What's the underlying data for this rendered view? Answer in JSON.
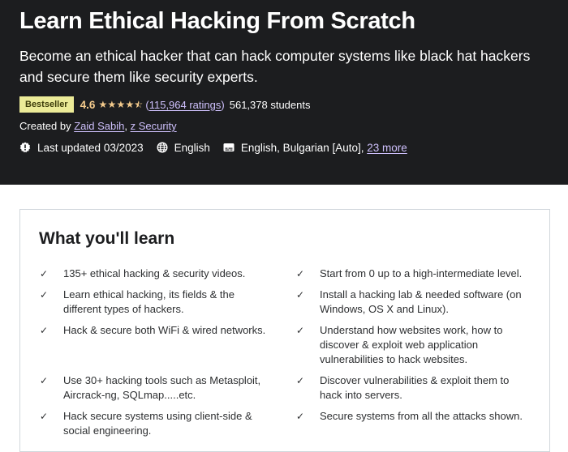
{
  "course": {
    "title": "Learn Ethical Hacking From Scratch",
    "subtitle": "Become an ethical hacker that can hack computer systems like black hat hackers and secure them like security experts.",
    "badge": "Bestseller",
    "rating": "4.6",
    "stars": {
      "value": 4.6,
      "max": 5
    },
    "ratings_open": "(",
    "ratings_link": "115,964 ratings",
    "ratings_close": ")",
    "students": "561,378 students",
    "created_by_label": "Created by",
    "instructors": [
      "Zaid Sabih",
      "z Security"
    ],
    "instructor_separator": ", ",
    "last_updated": "Last updated 03/2023",
    "language": "English",
    "captions": "English, Bulgarian [Auto],",
    "captions_more_link": "23 more"
  },
  "icons": {
    "update": "alert-badge-icon",
    "language": "globe-icon",
    "captions": "closed-captions-icon",
    "check": "checkmark-icon",
    "star": "star-icon"
  },
  "colors": {
    "hero_bg": "#1c1d1f",
    "badge_bg": "#eceb98",
    "star": "#f3ca8c",
    "link": "#cec0fc"
  },
  "learn": {
    "title": "What you'll learn",
    "left": [
      "135+ ethical hacking & security videos.",
      "Learn ethical hacking, its fields & the different types of hackers.",
      "Hack & secure both WiFi & wired networks.",
      "Use 30+ hacking tools such as Metasploit, Aircrack-ng, SQLmap.....etc.",
      "Hack secure systems using client-side & social engineering."
    ],
    "right": [
      "Start from 0 up to a high-intermediate level.",
      "Install a hacking lab & needed software (on Windows, OS X and Linux).",
      "Understand how websites work, how to discover & exploit web application vulnerabilities to hack websites.",
      "Discover vulnerabilities & exploit them to hack into servers.",
      "Secure systems from all the attacks shown."
    ]
  }
}
